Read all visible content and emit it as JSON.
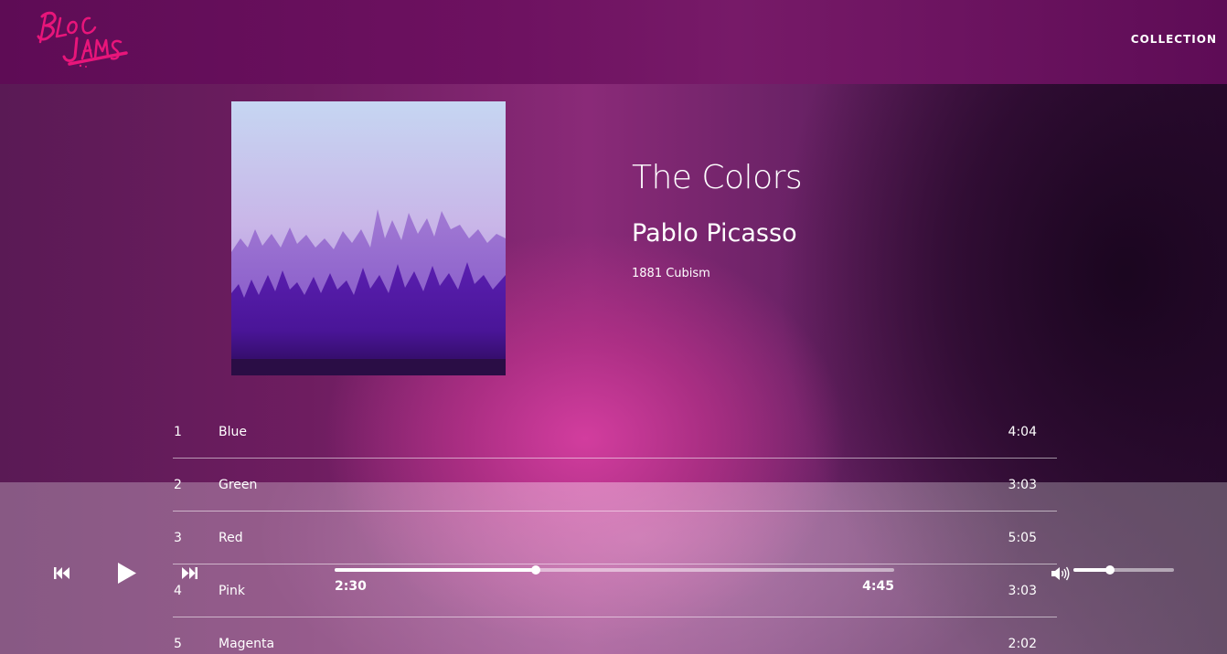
{
  "nav": {
    "logo_text": "Bloc Jams",
    "collection_link": "COLLECTION"
  },
  "album": {
    "title": "The Colors",
    "artist": "Pablo Picasso",
    "details": "1881 Cubism",
    "cover_icon": "misty-purple-forest-image"
  },
  "songs": [
    {
      "number": "1",
      "title": "Blue",
      "duration": "4:04"
    },
    {
      "number": "2",
      "title": "Green",
      "duration": "3:03"
    },
    {
      "number": "3",
      "title": "Red",
      "duration": "5:05"
    },
    {
      "number": "4",
      "title": "Pink",
      "duration": "3:03"
    },
    {
      "number": "5",
      "title": "Magenta",
      "duration": "2:02"
    }
  ],
  "player": {
    "previous_icon": "previous-track-icon",
    "play_icon": "play-icon",
    "next_icon": "next-track-icon",
    "volume_icon": "volume-icon",
    "current_time": "2:30",
    "total_time": "4:45",
    "seek_fraction": 0.36,
    "volume_fraction": 0.36
  },
  "colors": {
    "logo_pink": "#e8157a",
    "nav_bg": "#6d1160",
    "highlight_magenta": "#d63ea0"
  }
}
